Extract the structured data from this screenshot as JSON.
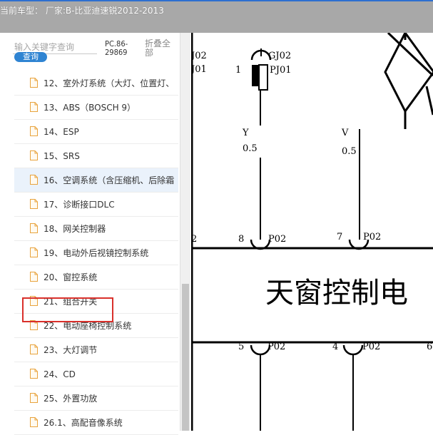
{
  "header": {
    "title": "当前车型：  厂家:B-比亚迪速锐2012-2013"
  },
  "sidebar": {
    "search_placeholder": "输入关键字查询",
    "search_button": "查询",
    "pc_code": "PC.86-29869",
    "collapse_all": "折叠全部",
    "items": [
      {
        "label": "12、室外灯系统（大灯、位置灯、"
      },
      {
        "label": "13、ABS（BOSCH 9）"
      },
      {
        "label": "14、ESP"
      },
      {
        "label": "15、SRS"
      },
      {
        "label": "16、空调系统（含压缩机、后除霜"
      },
      {
        "label": "17、诊断接口DLC"
      },
      {
        "label": "18、网关控制器"
      },
      {
        "label": "19、电动外后视镜控制系统"
      },
      {
        "label": "20、窗控系统"
      },
      {
        "label": "21、组合开关"
      },
      {
        "label": "22、电动座椅控制系统"
      },
      {
        "label": "23、大灯调节"
      },
      {
        "label": "24、CD"
      },
      {
        "label": "25、外置功放"
      },
      {
        "label": "26.1、高配音像系统"
      }
    ]
  },
  "diagram": {
    "title": "天窗控制电",
    "connectors": {
      "top_left_codes": [
        "J02",
        "J01"
      ],
      "gj02": "GJ02",
      "pin1": "1",
      "pj01": "PJ01",
      "wire1_color": "Y",
      "wire1_size": "0.5",
      "wire2_color": "V",
      "wire2_size": "0.5",
      "pin_left_mid": "2",
      "pin8": "8",
      "p02_a": "P02",
      "pin7": "7",
      "p02_b": "P02",
      "pin5": "5",
      "p02_c": "P02",
      "pin4": "4",
      "p02_d": "P02",
      "pin6": "6"
    }
  }
}
